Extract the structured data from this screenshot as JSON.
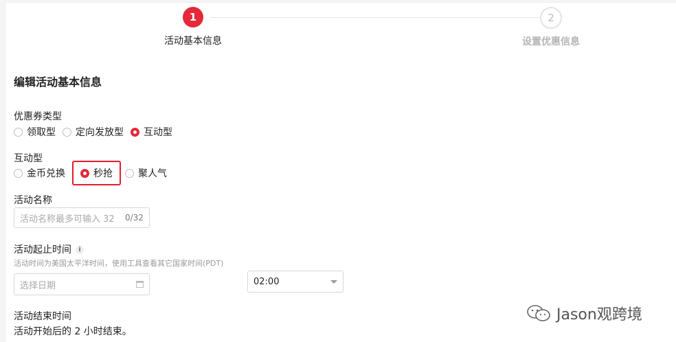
{
  "stepper": {
    "steps": [
      {
        "number": "1",
        "label": "活动基本信息"
      },
      {
        "number": "2",
        "label": "设置优惠信息"
      }
    ],
    "active_color": "#e4293a"
  },
  "form": {
    "title": "编辑活动基本信息",
    "coupon_type": {
      "label": "优惠券类型",
      "options": [
        "领取型",
        "定向发放型",
        "互动型"
      ],
      "selected": "互动型"
    },
    "interactive_type": {
      "label": "互动型",
      "options": [
        "金币兑换",
        "秒抢",
        "聚人气"
      ],
      "selected": "秒抢"
    },
    "activity_name": {
      "label": "活动名称",
      "placeholder": "活动名称最多可输入 32",
      "counter": "0/32"
    },
    "start_time": {
      "label": "活动起止时间",
      "info_icon": "i",
      "hint": "活动时间为美国太平洋时间，使用工具查看其它国家时间(PDT)",
      "date_placeholder": "选择日期",
      "time_value": "02:00"
    },
    "end_time": {
      "label": "活动结束时间",
      "value": "活动开始后的 2 小时结束。"
    }
  },
  "watermark": {
    "text": "Jason观跨境",
    "icon": "wechat-icon"
  }
}
